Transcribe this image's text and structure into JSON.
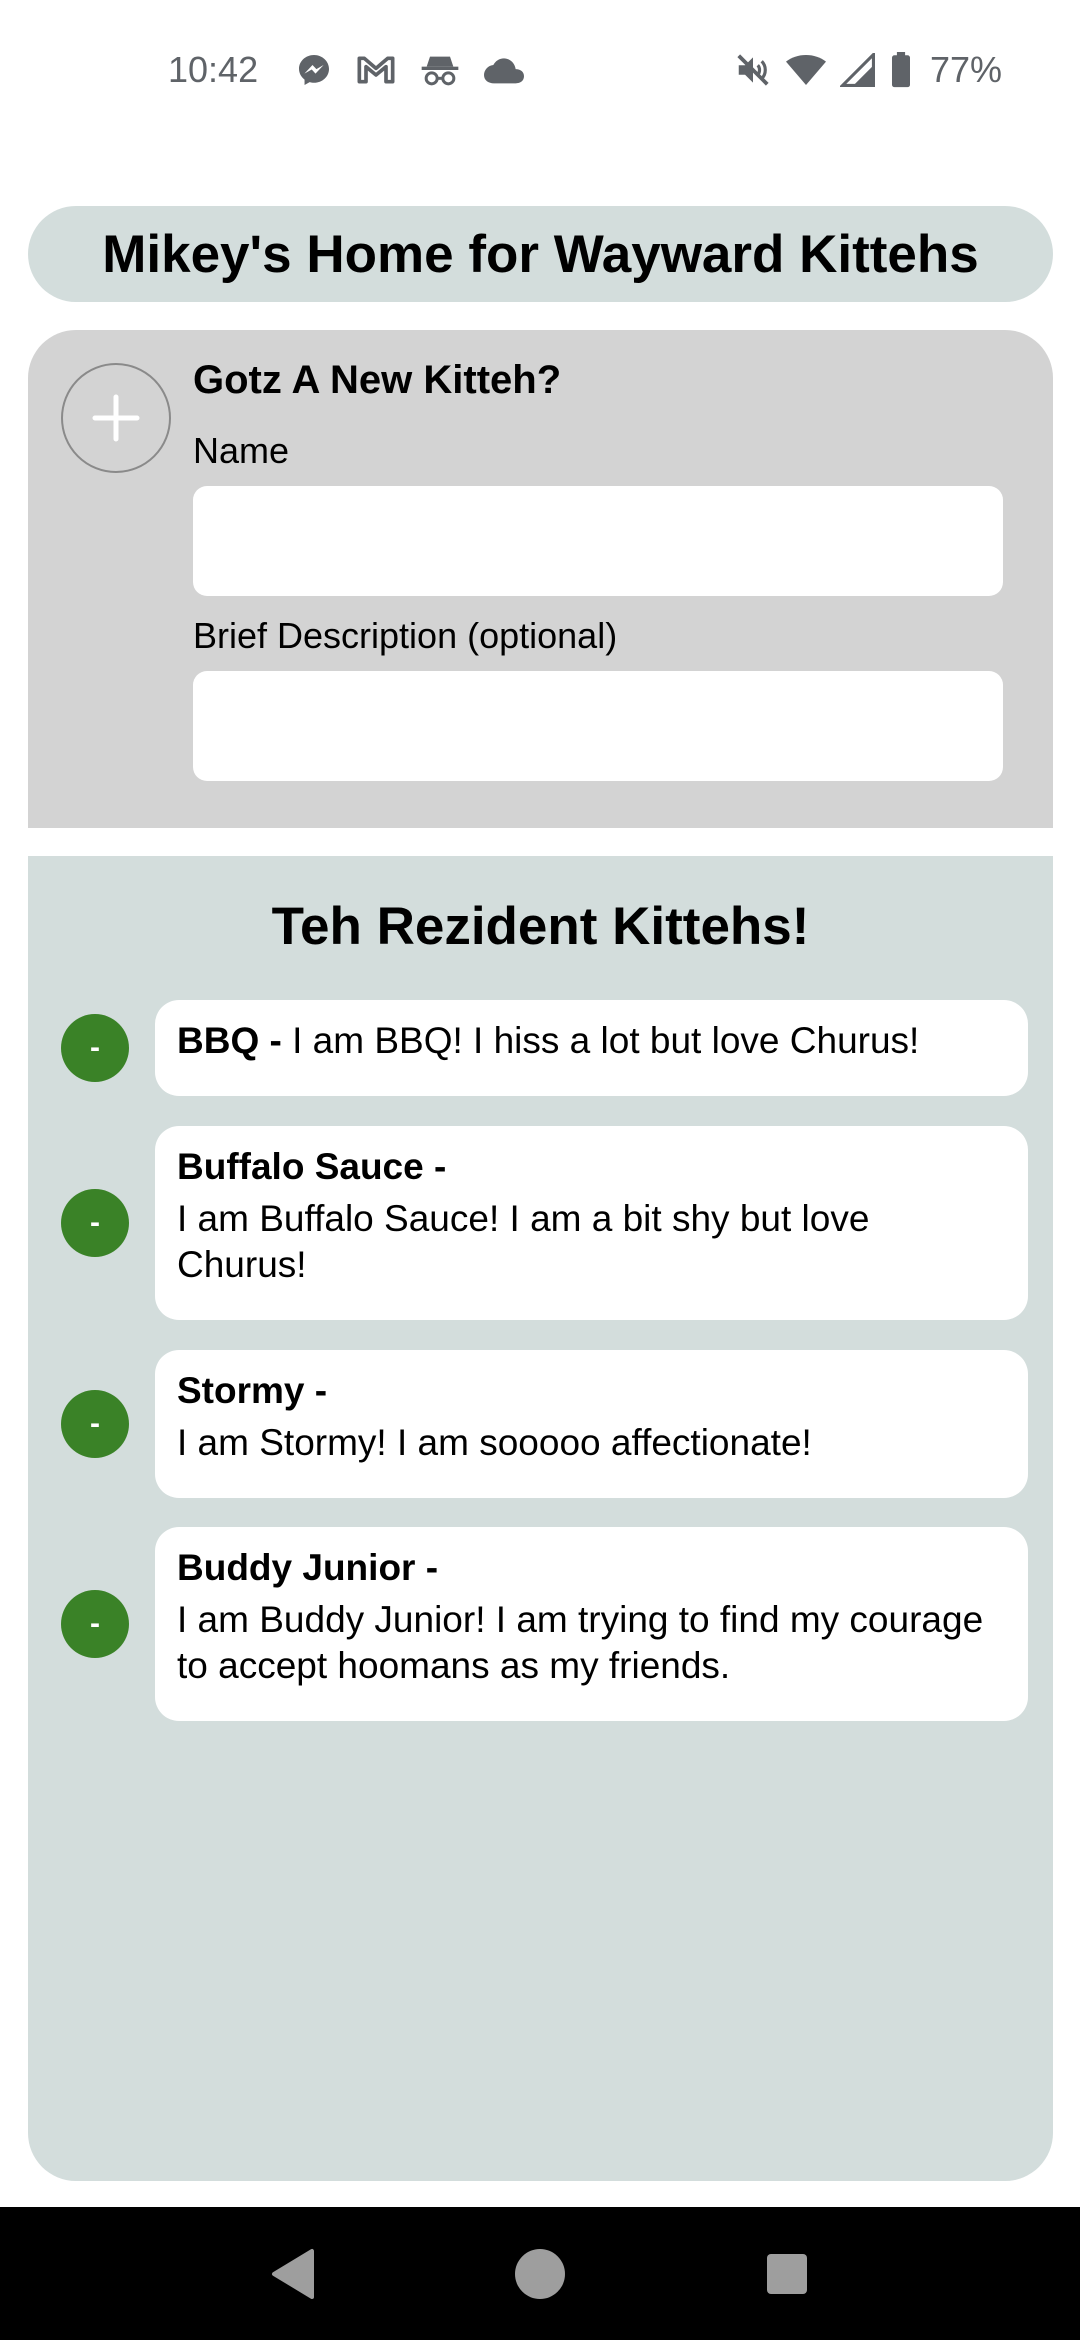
{
  "status_bar": {
    "time": "10:42",
    "notification_icons": [
      "messenger-icon",
      "gmail-icon",
      "incognito-icon",
      "cloud-icon"
    ],
    "system_icons": [
      "mute-icon",
      "wifi-icon",
      "signal-icon",
      "battery-icon"
    ],
    "battery": "77%"
  },
  "header": {
    "title": "Mikey's Home for Wayward Kittehs"
  },
  "add_form": {
    "heading": "Gotz A New Kitteh?",
    "name_label": "Name",
    "name_value": "",
    "description_label": "Brief Description (optional)",
    "description_value": ""
  },
  "residents": {
    "heading": "Teh Rezident Kittehs!",
    "remove_label": "-",
    "items": [
      {
        "name": "BBQ -",
        "description": "I am BBQ! I hiss a lot but love Churus!"
      },
      {
        "name": "Buffalo Sauce -",
        "description": "I am Buffalo Sauce! I am a bit shy but love Churus!"
      },
      {
        "name": "Stormy -",
        "description": "I am Stormy! I am sooooo affectionate!"
      },
      {
        "name": "Buddy Junior -",
        "description": "I am Buddy Junior! I am trying to find my courage to accept hoomans as my friends."
      }
    ]
  },
  "colors": {
    "title_bg": "#d3dddc",
    "form_bg": "#d3d3d3",
    "list_bg": "#d3dddc",
    "remove_button": "#3a8227",
    "nav_bar": "#000000"
  }
}
